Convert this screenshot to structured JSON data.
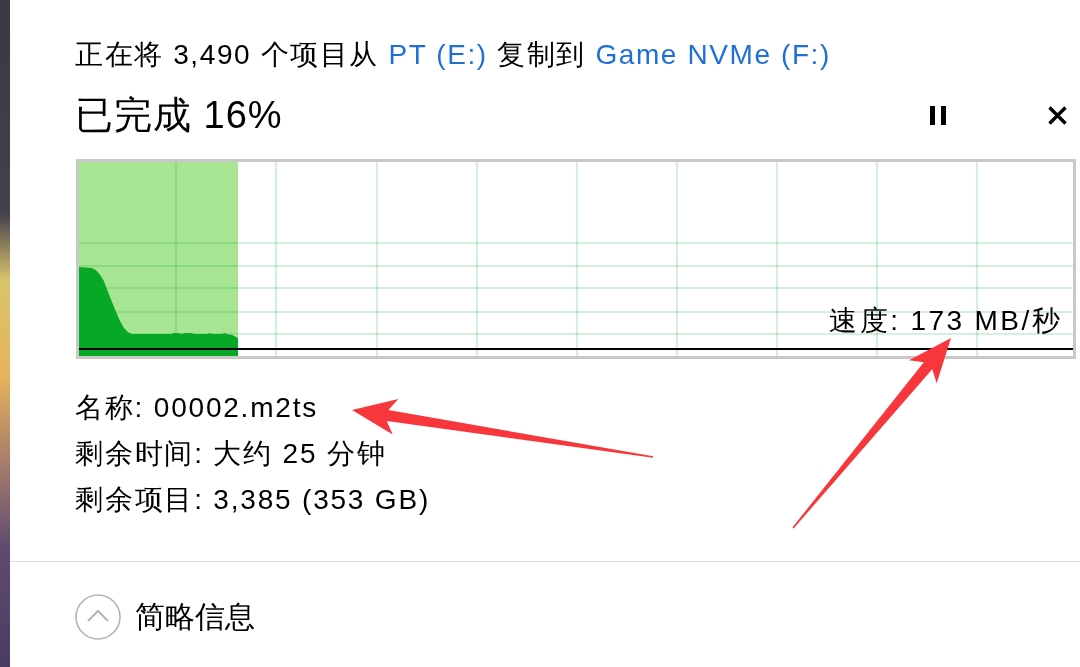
{
  "header": {
    "parts": [
      {
        "kind": "text",
        "text": "正在将 3,490 个项目从"
      },
      {
        "kind": "link",
        "text": "PT (E:)"
      },
      {
        "kind": "text",
        "text": "复制到"
      },
      {
        "kind": "link",
        "text": "Game NVMe (F:)"
      }
    ]
  },
  "status": "已完成 16%",
  "progress": {
    "level": 0.16
  },
  "speed": "速度: 173 MB/秒",
  "details": [
    "名称: 00002.m2ts",
    "剩余时间: 大约 25 分钟",
    "剩余项目: 3,385 (353 GB)"
  ],
  "footer": {
    "label": "简略信息",
    "expanded": true
  }
}
